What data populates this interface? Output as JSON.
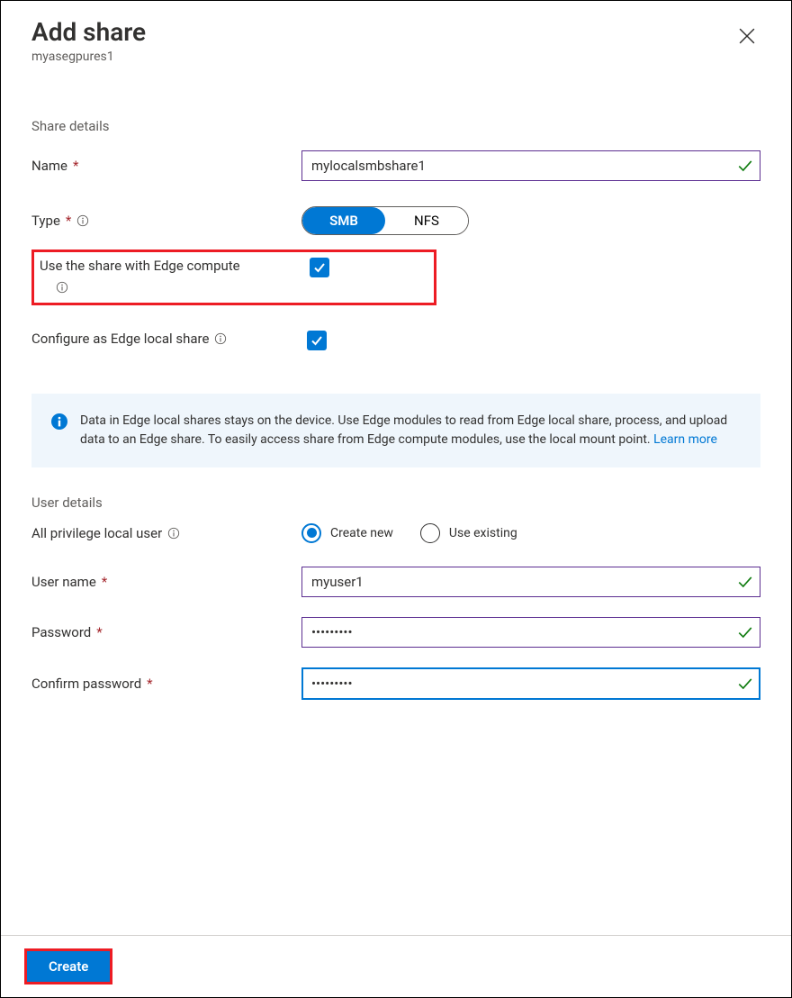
{
  "panel": {
    "title": "Add share",
    "subtitle": "myasegpures1"
  },
  "share_details": {
    "section_label": "Share details",
    "name_label": "Name",
    "name_value": "mylocalsmbshare1",
    "type_label": "Type",
    "type_options": {
      "smb": "SMB",
      "nfs": "NFS"
    },
    "type_selected": "SMB",
    "edge_compute_label": "Use the share with Edge compute",
    "edge_compute_checked": true,
    "local_share_label": "Configure as Edge local share",
    "local_share_checked": true
  },
  "info_callout": {
    "text": "Data in Edge local shares stays on the device. Use Edge modules to read from Edge local share, process, and upload data to an Edge share. To easily access share from Edge compute modules, use the local mount point. ",
    "link_text": "Learn more"
  },
  "user_details": {
    "section_label": "User details",
    "privilege_label": "All privilege local user",
    "radio_create": "Create new",
    "radio_existing": "Use existing",
    "radio_selected": "create",
    "username_label": "User name",
    "username_value": "myuser1",
    "password_label": "Password",
    "password_value": "•••••••••",
    "confirm_label": "Confirm password",
    "confirm_value": "•••••••••"
  },
  "footer": {
    "create_label": "Create"
  }
}
